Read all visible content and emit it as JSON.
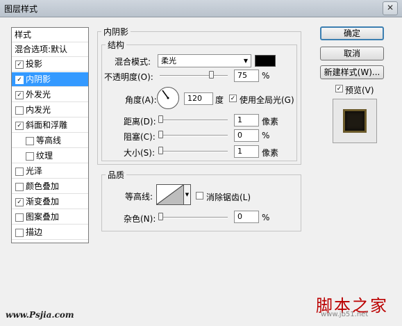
{
  "window": {
    "title": "图层样式",
    "close_glyph": "✕"
  },
  "styles_panel": {
    "header": "样式",
    "blend_options": "混合选项:默认",
    "items": [
      {
        "label": "投影",
        "checked": true,
        "indent": false,
        "selected": false
      },
      {
        "label": "内阴影",
        "checked": true,
        "indent": false,
        "selected": true
      },
      {
        "label": "外发光",
        "checked": true,
        "indent": false,
        "selected": false
      },
      {
        "label": "内发光",
        "checked": false,
        "indent": false,
        "selected": false
      },
      {
        "label": "斜面和浮雕",
        "checked": true,
        "indent": false,
        "selected": false
      },
      {
        "label": "等高线",
        "checked": false,
        "indent": true,
        "selected": false
      },
      {
        "label": "纹理",
        "checked": false,
        "indent": true,
        "selected": false
      },
      {
        "label": "光泽",
        "checked": false,
        "indent": false,
        "selected": false
      },
      {
        "label": "颜色叠加",
        "checked": false,
        "indent": false,
        "selected": false
      },
      {
        "label": "渐变叠加",
        "checked": true,
        "indent": false,
        "selected": false
      },
      {
        "label": "图案叠加",
        "checked": false,
        "indent": false,
        "selected": false
      },
      {
        "label": "描边",
        "checked": false,
        "indent": false,
        "selected": false
      }
    ]
  },
  "inner_shadow": {
    "section_title": "内阴影",
    "structure_title": "结构",
    "blend_mode_label": "混合模式:",
    "blend_mode_value": "柔光",
    "blend_color": "#000000",
    "opacity_label": "不透明度(O):",
    "opacity_value": "75",
    "opacity_unit": "%",
    "opacity_level": 0.75,
    "angle_label": "角度(A):",
    "angle_value": "120",
    "angle_unit": "度",
    "global_light_label": "使用全局光(G)",
    "global_light_checked": true,
    "distance_label": "距离(D):",
    "distance_value": "1",
    "distance_unit": "像素",
    "choke_label": "阻塞(C):",
    "choke_value": "0",
    "choke_unit": "%",
    "size_label": "大小(S):",
    "size_value": "1",
    "size_unit": "像素"
  },
  "quality": {
    "title": "品质",
    "contour_label": "等高线:",
    "anti_alias_label": "消除锯齿(L)",
    "anti_alias_checked": false,
    "noise_label": "杂色(N):",
    "noise_value": "0",
    "noise_unit": "%"
  },
  "buttons": {
    "ok": "确定",
    "cancel": "取消",
    "new_style": "新建样式(W)...",
    "preview_label": "预览(V)",
    "preview_checked": true
  },
  "watermark": {
    "left": "www.Psjia.com",
    "right": "脚本之家",
    "right_sub": "www.jb51.net"
  },
  "icons": {
    "check": "✓",
    "dropdown": "▼",
    "close": "close-icon"
  }
}
